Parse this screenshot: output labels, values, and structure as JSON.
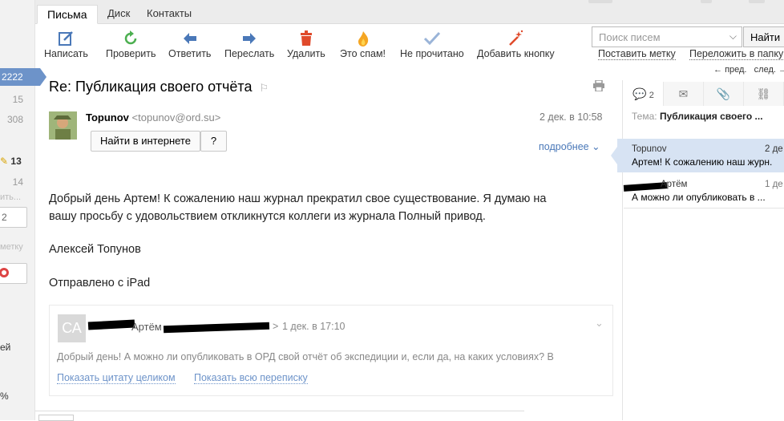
{
  "left": {
    "counts": [
      "2222",
      "15",
      "308",
      "13",
      "14"
    ],
    "partials": [
      "ить...",
      "метку",
      "ей",
      "%"
    ]
  },
  "tabs": [
    "Письма",
    "Диск",
    "Контакты"
  ],
  "toolbar": [
    {
      "label": "Написать",
      "icon": "compose-icon"
    },
    {
      "label": "Проверить",
      "icon": "refresh-icon"
    },
    {
      "label": "Ответить",
      "icon": "reply-arrow-icon"
    },
    {
      "label": "Переслать",
      "icon": "forward-arrow-icon"
    },
    {
      "label": "Удалить",
      "icon": "trash-icon"
    },
    {
      "label": "Это спам!",
      "icon": "fire-icon"
    },
    {
      "label": "Не прочитано",
      "icon": "checkmark-icon"
    },
    {
      "label": "Добавить кнопку",
      "icon": "magic-wand-icon"
    }
  ],
  "search": {
    "placeholder": "Поиск писем",
    "button": "Найти"
  },
  "toplinks": {
    "mark": "Поставить метку",
    "move": "Переложить в папку",
    "prev": "пред.",
    "next": "след."
  },
  "message": {
    "subject": "Re: Публикация своего отчёта",
    "sender_name": "Topunov",
    "sender_email": "<topunov@ord.su>",
    "date": "2 дек. в 10:58",
    "find_button": "Найти в интернете",
    "help_button": "?",
    "more": "подробнее",
    "body_line1": "Добрый день Артем! К сожалению наш журнал прекратил свое существование. Я думаю на",
    "body_line2": "вашу просьбу с удовольствием откликнутся коллеги из журнала Полный привод.",
    "signature": "Алексей Топунов",
    "sent_from": "Отправлено с iPad"
  },
  "quote": {
    "avatar_initials": "СА",
    "name_visible": "Артём",
    "date": "1 дек. в 17:10",
    "text": "Добрый день! А можно ли опубликовать в ОРД свой отчёт об экспедиции и, если да, на каких условиях? В",
    "show_quote": "Показать цитату целиком",
    "show_thread": "Показать всю переписку"
  },
  "thread": {
    "tab_count": "2",
    "topic_label": "Тема:",
    "topic": "Публикация своего ...",
    "items": [
      {
        "from": "Topunov",
        "date": "2 де",
        "snippet": "Артем! К сожалению наш журн."
      },
      {
        "from": "Артём",
        "date": "1 де",
        "snippet": "А можно ли опубликовать в ..."
      }
    ]
  }
}
